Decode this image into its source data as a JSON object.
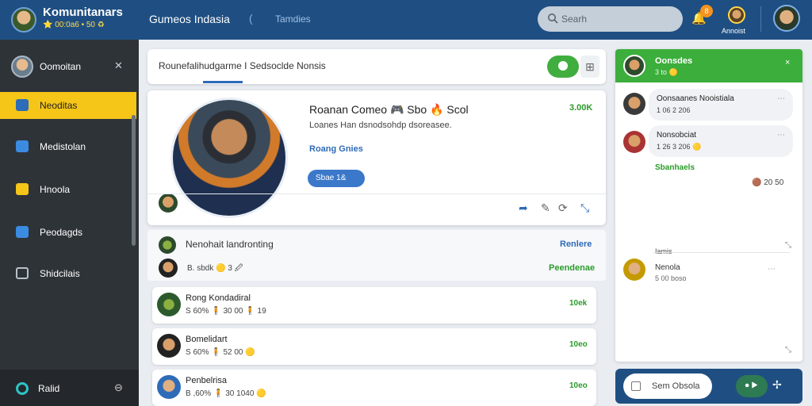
{
  "brand": {
    "title": "Komunitanars",
    "subtitle": "⭐ 00:0a6 • 50 ♻"
  },
  "topbar": {
    "title": "Gumeos Indasia",
    "divider": "(",
    "tab": "Tamdies",
    "search_placeholder": "Searh",
    "notif_badge": "8",
    "user_label": "Annoist"
  },
  "sidebar": {
    "user_name": "Oomoitan",
    "items": [
      {
        "label": "Neoditas",
        "icon": "news-icon",
        "active": true
      },
      {
        "label": "Medistolan",
        "icon": "folder-icon",
        "active": false
      },
      {
        "label": "Hnoola",
        "icon": "badge-icon",
        "active": false
      },
      {
        "label": "Peodagds",
        "icon": "blocks-icon",
        "active": false
      },
      {
        "label": "Shidcilais",
        "icon": "chat-icon",
        "active": false
      }
    ],
    "bottom_label": "Ralid"
  },
  "breadcrumb": {
    "text": "Rounefalihudgarme I Sedsoclde Nonsis"
  },
  "profile": {
    "name": "Roanan Comeo 🎮 Sbo 🔥 Scol",
    "meta": "Loanes Han dsnodsohdp dsoreasee.",
    "follow_label": "Roang Gnies",
    "count": "3.00K",
    "chip": "Sbae 1&"
  },
  "feed_head": {
    "title": "Nenohait landronting",
    "right1": "Renlere",
    "meta": "B. sbdk 🟡 3 🖉",
    "right2": "Peendenae"
  },
  "posts": [
    {
      "title": "Rong Kondadiral",
      "meta": "S 60% 🧍 30 00 🧍 19",
      "count": "10ek"
    },
    {
      "title": "Bomelidart",
      "meta": "S 60% 🧍 52 00 🟡",
      "count": "10eo"
    },
    {
      "title": "Penbelrisa",
      "meta": "B ,60% 🧍 30 1040 🟡",
      "count": "10eo"
    }
  ],
  "rpanel": {
    "head_name": "Oonsdes",
    "head_sub": "3 to 🟡",
    "close": "×",
    "msgs": [
      {
        "name": "Oonsaanes Nooistiala",
        "meta": "1 06 2 206"
      },
      {
        "name": "Nonsobciat",
        "meta": "1 26 3 206 🟡"
      }
    ],
    "green_label": "Sbanhaels",
    "stat": "🟤 20 50",
    "small": "Iamis",
    "msg2_name": "Nenola",
    "msg2_meta": "5 00 boso",
    "input_placeholder": "Sem Obsola",
    "send_label": "⏺ ▶"
  },
  "colors": {
    "topbar": "#1f4f82",
    "sidebar": "#2e3338",
    "accent": "#f5c518",
    "green": "#3cae3c",
    "link": "#2e6bb8"
  }
}
